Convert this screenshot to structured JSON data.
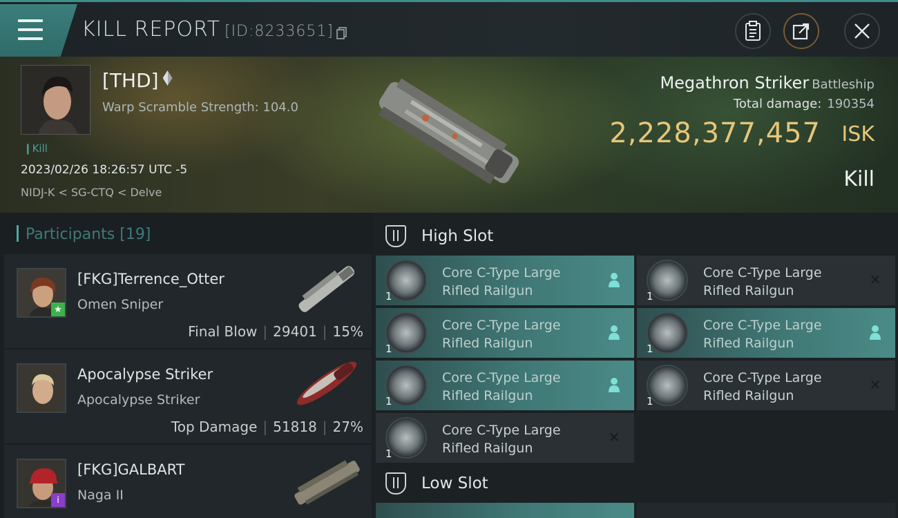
{
  "header": {
    "title": "KILL REPORT",
    "report_id": "[ID:8233651]"
  },
  "victim": {
    "corp_tag": "[THD]",
    "scram_strength": "Warp Scramble Strength: 104.0",
    "kill_tag": "Kill",
    "datetime": "2023/02/26 18:26:57 UTC -5",
    "location": "NIDJ-K < SG-CTQ < Delve",
    "ship_name": "Megathron Striker",
    "ship_class": "Battleship",
    "total_damage_label": "Total damage:",
    "total_damage": "190354",
    "isk_value": "2,228,377,457",
    "isk_unit": "ISK",
    "result": "Kill"
  },
  "participants": {
    "label": "Participants",
    "count": "[19]",
    "rows": [
      {
        "name": "[FKG]Terrence_Otter",
        "ship": "Omen Sniper",
        "tag": "Final Blow",
        "damage": "29401",
        "percent": "15%",
        "badge": "★",
        "badge_color": "#3db24a"
      },
      {
        "name": "Apocalypse Striker",
        "ship": "Apocalypse Striker",
        "tag": "Top Damage",
        "damage": "51818",
        "percent": "27%",
        "badge": "",
        "badge_color": ""
      },
      {
        "name": "[FKG]GALBART",
        "ship": "Naga II",
        "tag": "",
        "damage": "",
        "percent": "",
        "badge": "i",
        "badge_color": "#8a3fc8"
      }
    ]
  },
  "fitting": {
    "high_label": "High Slot",
    "low_label": "Low Slot",
    "modules": [
      {
        "line1": "Core C-Type Large",
        "line2": "Rifled Railgun",
        "qty": "1",
        "state": "person-icon"
      },
      {
        "line1": "Core C-Type Large",
        "line2": "Rifled Railgun",
        "qty": "1",
        "state": "close-icon"
      },
      {
        "line1": "Core C-Type Large",
        "line2": "Rifled Railgun",
        "qty": "1",
        "state": "person-icon"
      },
      {
        "line1": "Core C-Type Large",
        "line2": "Rifled Railgun",
        "qty": "1",
        "state": "person-icon"
      },
      {
        "line1": "Core C-Type Large",
        "line2": "Rifled Railgun",
        "qty": "1",
        "state": "person-icon"
      },
      {
        "line1": "Core C-Type Large",
        "line2": "Rifled Railgun",
        "qty": "1",
        "state": "close-icon"
      },
      {
        "line1": "Core C-Type Large",
        "line2": "Rifled Railgun",
        "qty": "1",
        "state": "close-icon"
      }
    ]
  },
  "colors": {
    "accent": "#4fa7a4",
    "isk": "#e6c67a"
  }
}
